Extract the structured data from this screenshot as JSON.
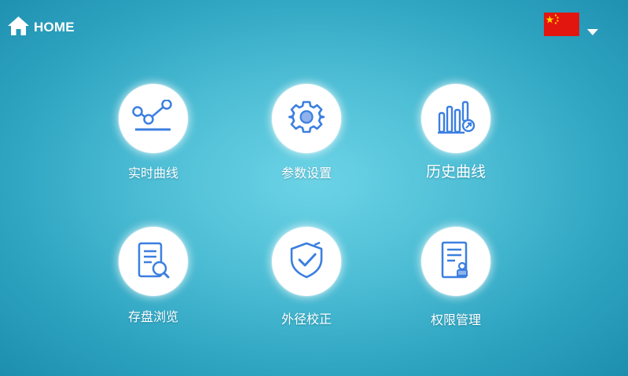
{
  "header": {
    "home_label": "HOME",
    "home_icon": "home-icon",
    "language": {
      "flag_icon": "china-flag-icon",
      "dropdown_icon": "caret-down-icon"
    }
  },
  "menu": [
    {
      "label": "实时曲线",
      "icon": "line-chart-icon"
    },
    {
      "label": "参数设置",
      "icon": "gear-icon"
    },
    {
      "label": "历史曲线",
      "icon": "bar-chart-icon"
    },
    {
      "label": "存盘浏览",
      "icon": "document-search-icon"
    },
    {
      "label": "外径校正",
      "icon": "shield-check-icon"
    },
    {
      "label": "权限管理",
      "icon": "permission-document-icon"
    }
  ],
  "colors": {
    "background": "#3fb2cc",
    "icon_blue": "#3b7fe0",
    "circle": "#ffffff",
    "flag_red": "#e3160f",
    "flag_yellow": "#ffde00"
  }
}
